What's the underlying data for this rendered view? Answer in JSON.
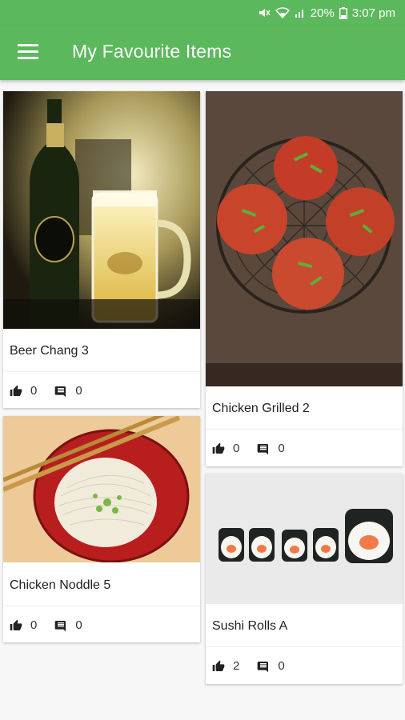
{
  "status_bar": {
    "battery": "20%",
    "time": "3:07 pm"
  },
  "app_bar": {
    "title": "My Favourite Items"
  },
  "items": [
    {
      "name": "Beer Chang 3",
      "likes": "0",
      "comments": "0"
    },
    {
      "name": "Chicken Grilled 2",
      "likes": "0",
      "comments": "0"
    },
    {
      "name": "Chicken Noddle 5",
      "likes": "0",
      "comments": "0"
    },
    {
      "name": "Sushi Rolls A",
      "likes": "2",
      "comments": "0"
    }
  ],
  "colors": {
    "primary": "#5cb85c",
    "background": "#f7f7f7"
  },
  "icons": [
    "menu-icon",
    "mute-icon",
    "wifi-icon",
    "signal-icon",
    "battery-icon",
    "thumb-up-icon",
    "comment-icon"
  ]
}
